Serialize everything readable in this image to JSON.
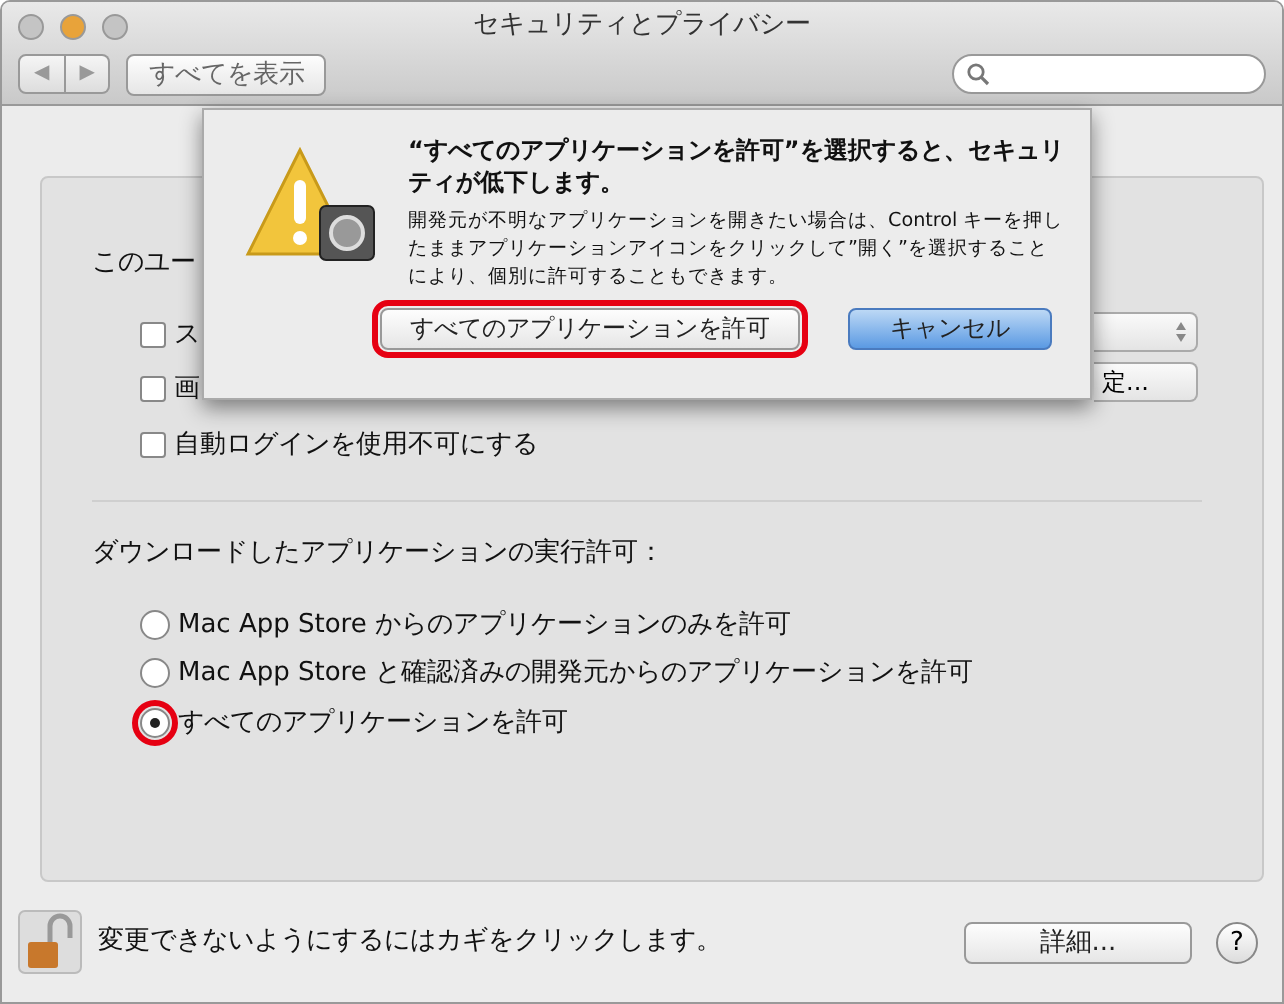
{
  "window": {
    "title": "セキュリティとプライバシー",
    "traffic_lights": [
      {
        "color": "#c4c4c4"
      },
      {
        "color": "#e8a33a"
      },
      {
        "color": "#c4c4c4"
      }
    ]
  },
  "toolbar": {
    "nav": [
      "◀",
      "▶"
    ],
    "show_all": "すべてを表示"
  },
  "panel": {
    "partial_heading": "このユー",
    "checkboxes": [
      {
        "label": "ス",
        "checked": false
      },
      {
        "label": "画",
        "checked": false
      },
      {
        "label": "自動ログインを使用不可にする",
        "checked": false
      }
    ],
    "partial_button": "定...",
    "download_label": "ダウンロードしたアプリケーションの実行許可：",
    "radios": [
      {
        "label": "Mac App Store からのアプリケーションのみを許可",
        "selected": false,
        "highlighted": false
      },
      {
        "label": "Mac App Store と確認済みの開発元からのアプリケーションを許可",
        "selected": false,
        "highlighted": false
      },
      {
        "label": "すべてのアプリケーションを許可",
        "selected": true,
        "highlighted": true
      }
    ]
  },
  "dialog": {
    "title": "“すべてのアプリケーションを許可”を選択すると、セキュリティが低下します。",
    "message": "開発元が不明なアプリケーションを開きたい場合は、Control キーを押したままアプリケーションアイコンをクリックして”開く”を選択することにより、個別に許可することもできます。",
    "buttons": [
      {
        "label": "すべてのアプリケーションを許可",
        "kind": "normal",
        "highlighted": true
      },
      {
        "label": "キャンセル",
        "kind": "default",
        "highlighted": false
      }
    ]
  },
  "footer": {
    "lock_text": "変更できないようにするにはカギをクリックします。",
    "advanced_button": "詳細...",
    "help": "?"
  }
}
